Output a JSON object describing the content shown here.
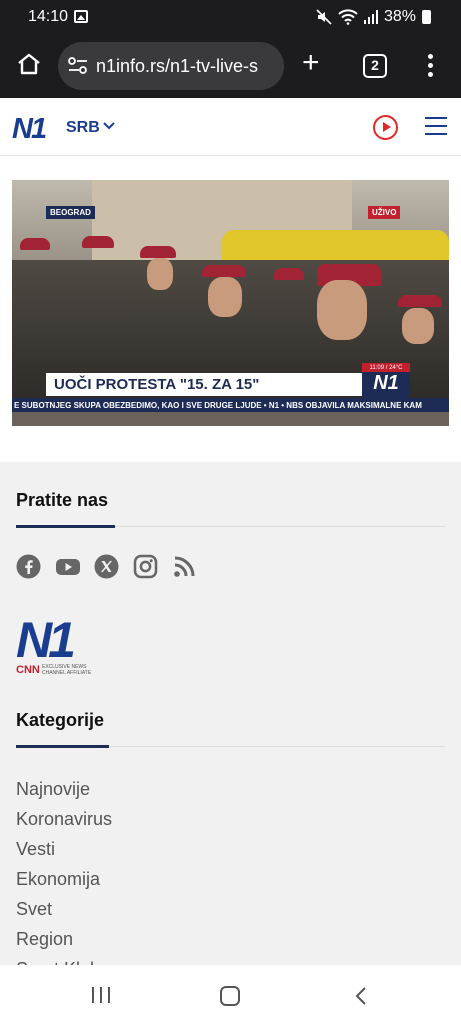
{
  "status": {
    "time": "14:10",
    "battery": "38%"
  },
  "browser": {
    "url": "n1info.rs/n1-tv-live-s",
    "tab_count": "2"
  },
  "site": {
    "logo": "N1",
    "region": "SRB"
  },
  "video": {
    "location_tag": "BEOGRAD",
    "live_tag": "UŽIVO",
    "headline": "UOČI PROTESTA \"15. ZA 15\"",
    "clock": "11:09 / 24°C",
    "ticker": "E SUBOTNJEG SKUPA OBEZBEDIMO, KAO I SVE DRUGE LJUDE • N1 • NBS OBJAVILA MAKSIMALNE KAM",
    "channel_badge": "N1"
  },
  "footer": {
    "follow_title": "Pratite nas",
    "social_icons": [
      "facebook-icon",
      "youtube-icon",
      "x-icon",
      "instagram-icon",
      "rss-icon"
    ],
    "brand_logo": "N1",
    "cnn_label": "CNN",
    "affiliate": "EXCLUSIVE NEWS CHANNEL AFFILIATE",
    "categories_title": "Kategorije",
    "categories": [
      "Najnovije",
      "Koronavirus",
      "Vesti",
      "Ekonomija",
      "Svet",
      "Region",
      "Sport Klub"
    ]
  },
  "colors": {
    "brand": "#1a3d8f",
    "accent": "#e02a2a",
    "live": "#c3202f"
  }
}
